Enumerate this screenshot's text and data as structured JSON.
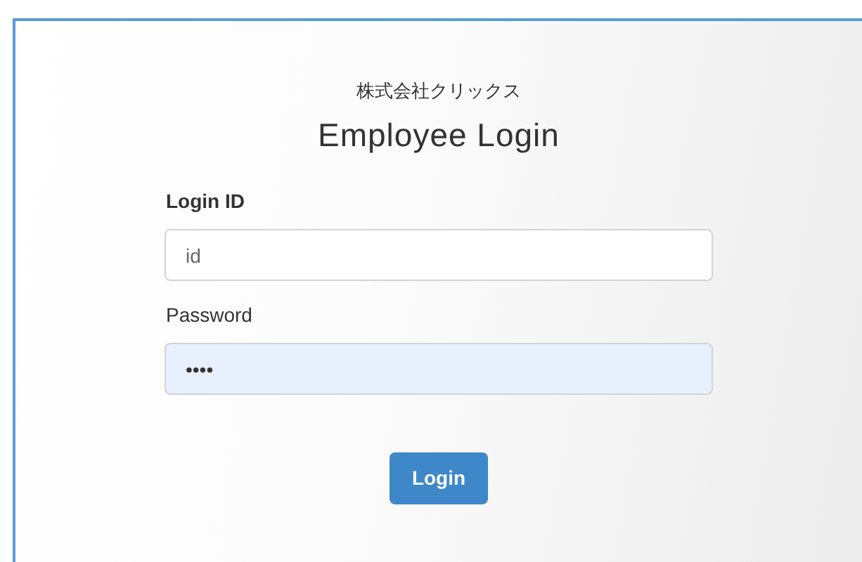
{
  "company": "株式会社クリックス",
  "title": "Employee Login",
  "fields": [
    {
      "label": "Login ID",
      "placeholder": "id",
      "autofilled": false
    },
    {
      "label": "Password",
      "value": "••••",
      "autofilled": true
    }
  ],
  "button": "Login"
}
